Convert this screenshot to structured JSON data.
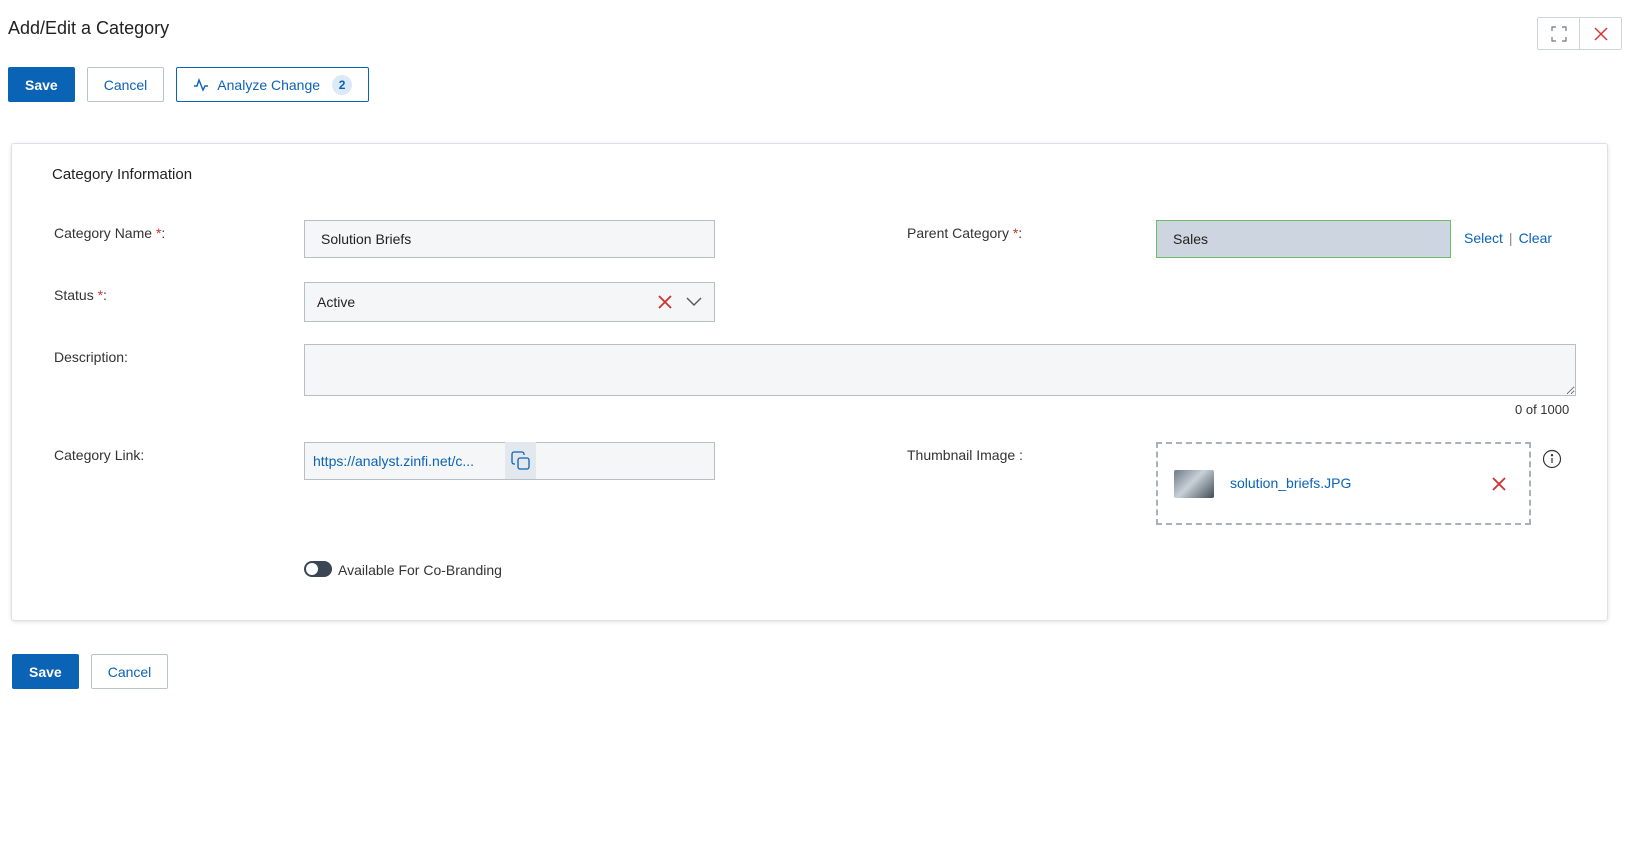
{
  "header": {
    "title": "Add/Edit a Category",
    "fullscreen_icon": "expand-icon",
    "close_icon": "close-icon"
  },
  "toolbar": {
    "save_label": "Save",
    "cancel_label": "Cancel",
    "analyze_label": "Analyze Change",
    "analyze_count": "2",
    "analyze_icon": "activity-icon"
  },
  "section": {
    "title": "Category Information"
  },
  "form": {
    "category_name": {
      "label": "Category Name",
      "required_mark": "*",
      "suffix": ":",
      "value": "Solution Briefs"
    },
    "parent_category": {
      "label": "Parent Category",
      "required_mark": "*",
      "suffix": ":",
      "value": "Sales",
      "select_label": "Select",
      "separator": "|",
      "clear_label": "Clear"
    },
    "status": {
      "label": "Status",
      "required_mark": "*",
      "suffix": ":",
      "value": "Active"
    },
    "description": {
      "label": "Description:",
      "value": "",
      "counter": "0 of 1000"
    },
    "category_link": {
      "label": "Category Link:",
      "value": "https://analyst.zinfi.net/c..."
    },
    "thumbnail": {
      "label": "Thumbnail Image :",
      "file_name": "solution_briefs.JPG"
    },
    "co_branding": {
      "label": "Available For Co-Branding",
      "enabled": false
    }
  },
  "colors": {
    "primary": "#0b63b6",
    "danger": "#d32f2f",
    "parent_field_bg": "#cdd6e0"
  }
}
